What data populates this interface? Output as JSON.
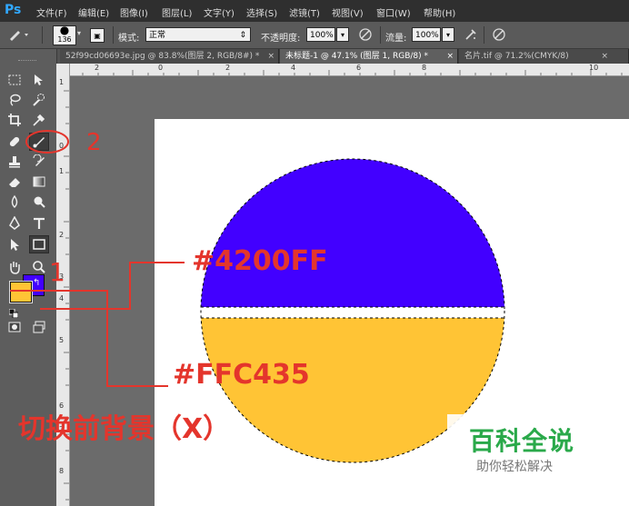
{
  "app": {
    "logo": "Ps"
  },
  "menu": [
    "文件(F)",
    "编辑(E)",
    "图像(I)",
    "图层(L)",
    "文字(Y)",
    "选择(S)",
    "滤镜(T)",
    "视图(V)",
    "窗口(W)",
    "帮助(H)"
  ],
  "options": {
    "brush_size": "136",
    "mode_label": "模式:",
    "mode_value": "正常",
    "opacity_label": "不透明度:",
    "opacity_value": "100%",
    "flow_label": "流量:",
    "flow_value": "100%"
  },
  "tabs": [
    {
      "label": "52f99cd06693e.jpg @ 83.8%(图层 2, RGB/8#) *",
      "close": "×"
    },
    {
      "label": "未标题-1 @ 47.1% (图层 1, RGB/8) *",
      "close": "×"
    },
    {
      "label": "名片.tif @ 71.2%(CMYK/8)",
      "close": "×"
    }
  ],
  "ruler_h_labels": [
    "2",
    "0",
    "2",
    "4",
    "6",
    "8",
    "10"
  ],
  "ruler_v_labels": [
    "1",
    "0",
    "1",
    "2",
    "3",
    "4",
    "5",
    "6",
    "7",
    "8"
  ],
  "icons": [
    "marquee-icon",
    "move-icon",
    "lasso-icon",
    "quick-select-icon",
    "crop-icon",
    "eyedropper-icon",
    "healing-icon",
    "brush-icon",
    "stamp-icon",
    "history-brush-icon",
    "eraser-icon",
    "gradient-icon",
    "blur-icon",
    "dodge-icon",
    "pen-icon",
    "type-icon",
    "path-select-icon",
    "rectangle-icon",
    "hand-icon",
    "zoom-icon",
    "swap-colors-icon",
    "default-colors-icon",
    "quick-mask-icon",
    "screen-mode-icon"
  ],
  "swatches": {
    "foreground": "#FFC435",
    "background": "#4200FF"
  },
  "circle": {
    "top_color": "#4200FF",
    "bottom_color": "#FFC435"
  },
  "annotations": {
    "step1": "1",
    "step2": "2",
    "bg_hex": "#4200FF",
    "fg_hex": "#FFC435",
    "swap_hint": "切换前背景（X）",
    "color": "#E4352C"
  },
  "watermark": {
    "title": "百科全说",
    "subtitle": "助你轻松解决",
    "color": "#2aa94a"
  }
}
